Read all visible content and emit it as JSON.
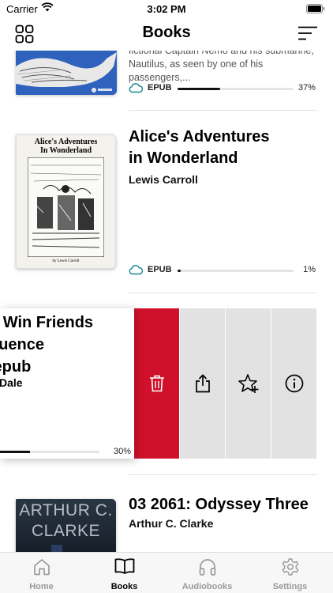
{
  "status_bar": {
    "carrier": "Carrier",
    "time": "3:02 PM"
  },
  "nav": {
    "title": "Books"
  },
  "books": [
    {
      "description": "fictional Captain Nemo and his submarine, Nautilus, as seen by one of his passengers,...",
      "format": "EPUB",
      "progress_percent": 37,
      "progress_label": "37%"
    },
    {
      "title_line1": "Alice's Adventures",
      "title_line2": "in Wonderland",
      "author": "Lewis Carroll",
      "format": "EPUB",
      "progress_percent": 1,
      "progress_label": "1%",
      "cover_title_line1": "Alice's Adventures",
      "cover_title_line2": "In Wonderland",
      "cover_author": "by Lewis Carroll"
    },
    {
      "title_line1": "o Win Friends",
      "title_line2": "fluence",
      "title_line3": ".epub",
      "author": "Dale",
      "progress_percent": 30,
      "progress_label": "30%"
    },
    {
      "title": "03 2061: Odyssey Three",
      "author": "Arthur C. Clarke",
      "cover_line1": "ARTHUR C.",
      "cover_line2": "CLARKE"
    }
  ],
  "swipe_actions": [
    "delete",
    "share",
    "favorite",
    "info"
  ],
  "tabs": [
    {
      "label": "Home",
      "icon": "home-icon",
      "active": false
    },
    {
      "label": "Books",
      "icon": "book-icon",
      "active": true
    },
    {
      "label": "Audiobooks",
      "icon": "headphones-icon",
      "active": false
    },
    {
      "label": "Settings",
      "icon": "gear-icon",
      "active": false
    }
  ],
  "colors": {
    "delete": "#d0112b",
    "action_bg": "#e2e2e2",
    "tab_active": "#000000",
    "tab_inactive": "#9a9a9a"
  }
}
